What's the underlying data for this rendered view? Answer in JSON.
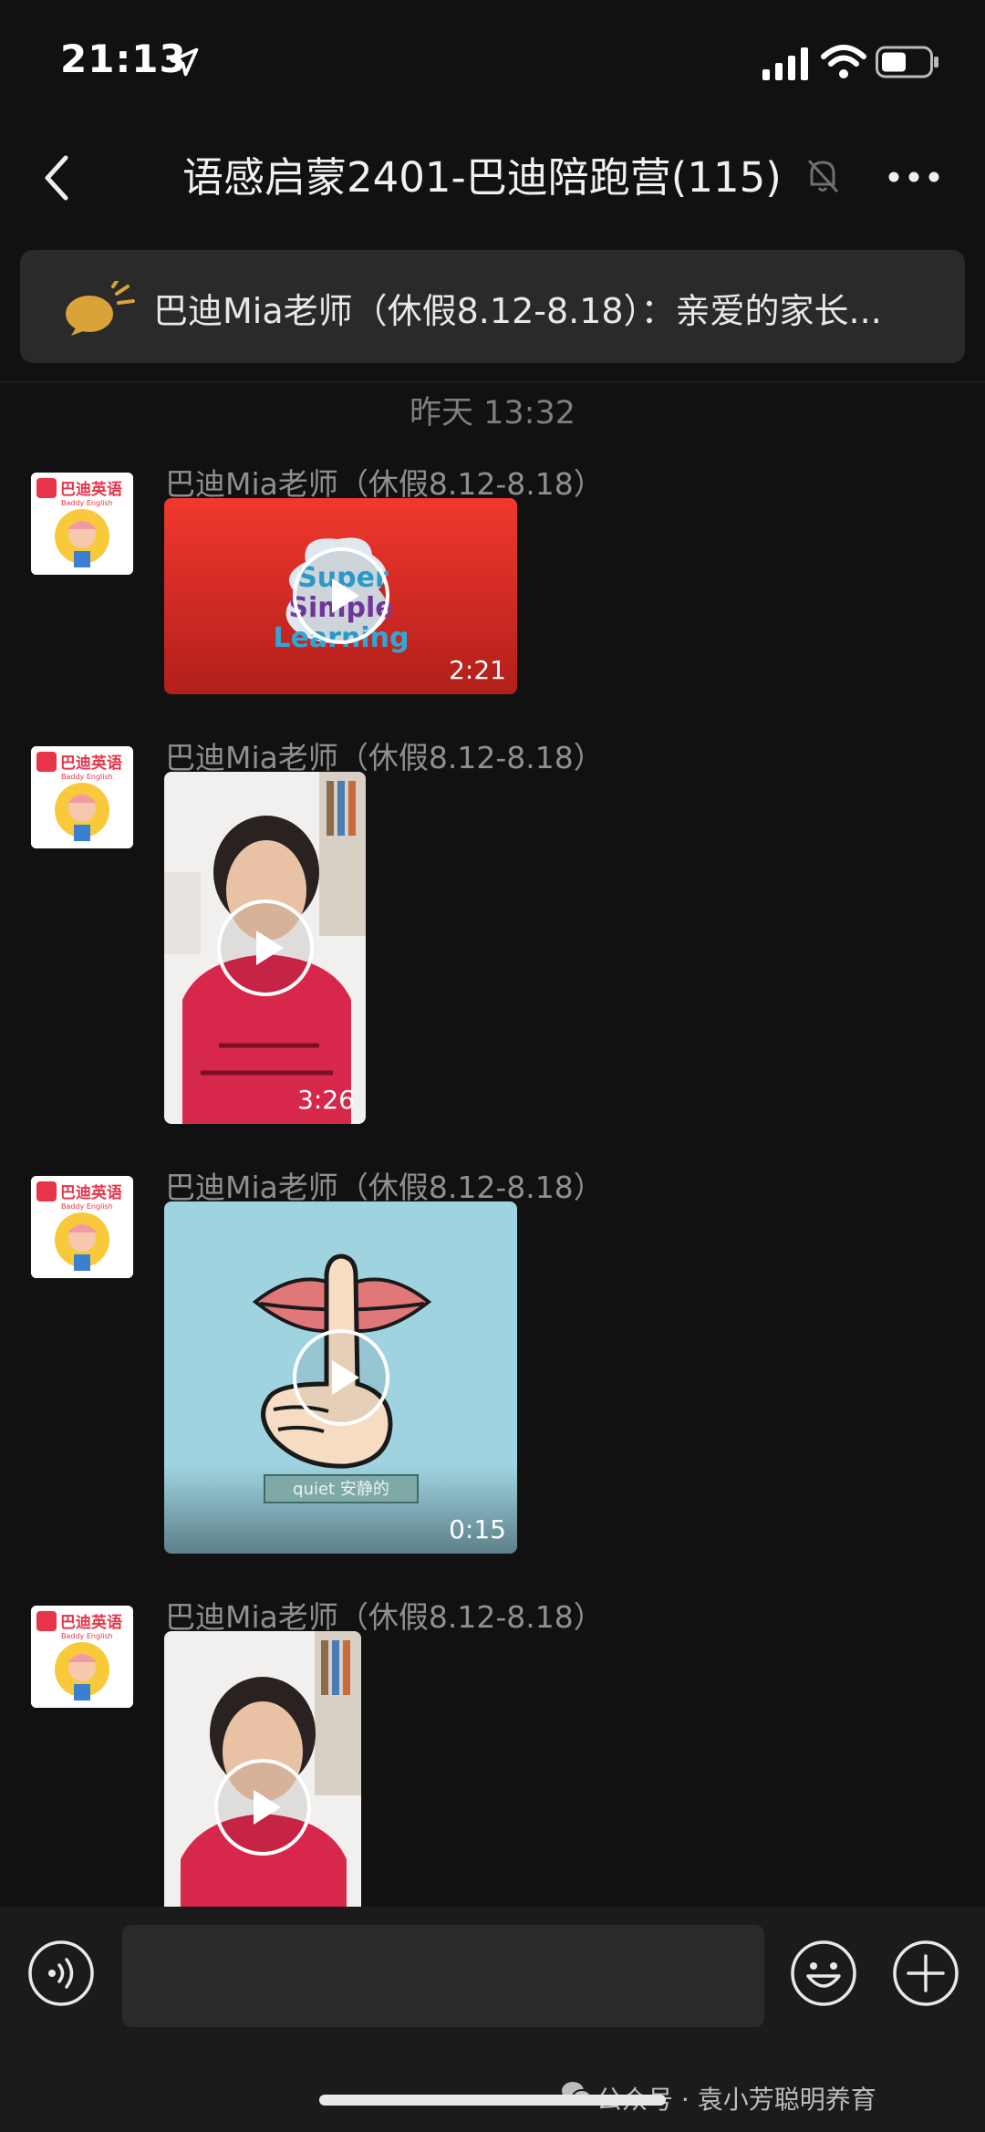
{
  "status_bar": {
    "time": "21:13"
  },
  "nav": {
    "title": "语感启蒙2401-巴迪陪跑营(115)"
  },
  "notice": {
    "text": "巴迪Mia老师（休假8.12-8.18）：亲爱的家长..."
  },
  "chat": {
    "timestamp": "昨天 13:32",
    "messages": [
      {
        "sender": "巴迪Mia老师（休假8.12-8.18）",
        "duration": "2:21",
        "thumb_text": [
          "Super",
          "Simple",
          "Learning"
        ]
      },
      {
        "sender": "巴迪Mia老师（休假8.12-8.18）",
        "duration": "3:26"
      },
      {
        "sender": "巴迪Mia老师（休假8.12-8.18）",
        "duration": "0:15",
        "caption": "quiet 安静的"
      },
      {
        "sender": "巴迪Mia老师（休假8.12-8.18）"
      }
    ],
    "avatar_text": {
      "brand": "巴迪英语",
      "sub": "Baddy English"
    }
  },
  "watermark": {
    "text": "公众号 · 袁小芳聪明养育"
  },
  "icons": [
    "location-arrow-icon",
    "signal-icon",
    "wifi-icon",
    "battery-icon",
    "back-chevron-icon",
    "bell-off-icon",
    "more-dots-icon",
    "announcement-icon",
    "play-icon",
    "voice-icon",
    "emoji-icon",
    "plus-icon",
    "wechat-icon"
  ],
  "colors": {
    "background": "#111111",
    "notice_bg": "#2a2a2a",
    "input_bar": "#1b1b1b",
    "video_red": "#e4322b",
    "video_blue": "#9fd3e0"
  }
}
